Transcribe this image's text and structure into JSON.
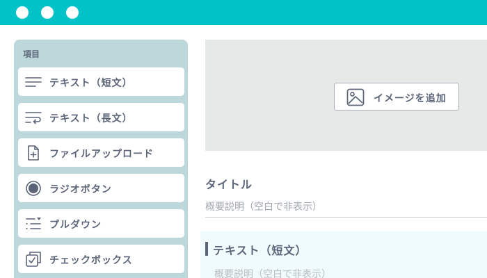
{
  "colors": {
    "accent": "#00c2c7",
    "sidebar_bg": "#bdd8db",
    "text": "#5b6478"
  },
  "sidebar": {
    "heading": "項目",
    "items": [
      {
        "label": "テキスト（短文）",
        "icon": "short-text-icon"
      },
      {
        "label": "テキスト（長文）",
        "icon": "long-text-icon"
      },
      {
        "label": "ファイルアップロード",
        "icon": "file-add-icon"
      },
      {
        "label": "ラジオボタン",
        "icon": "radio-button-icon"
      },
      {
        "label": "プルダウン",
        "icon": "dropdown-list-icon"
      },
      {
        "label": "チェックボックス",
        "icon": "checkbox-icon"
      }
    ]
  },
  "main": {
    "image_button_label": "イメージを追加",
    "image_button_icon": "image-icon",
    "title": "タイトル",
    "description_placeholder": "概要説明（空白で非表示）",
    "block": {
      "title": "テキスト（短文）",
      "description_placeholder": "概要説明（空白で非表示）"
    }
  }
}
